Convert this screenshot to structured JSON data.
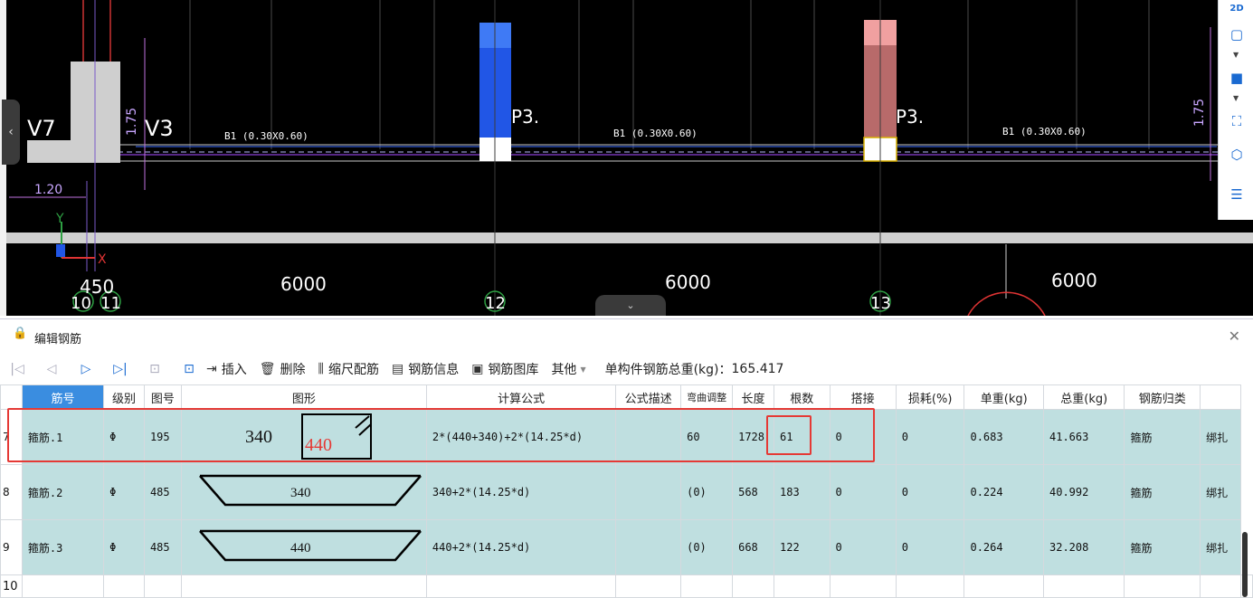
{
  "cad": {
    "axis_labels": [
      "10",
      "11",
      "12",
      "13"
    ],
    "dim_labels": [
      "450",
      "6000",
      "6000",
      "6000"
    ],
    "small_dim": "1.20",
    "vertical_dims": [
      "1.75",
      "1.75"
    ],
    "wall_labels": [
      "V7",
      "V3"
    ],
    "column_labels": [
      "P3.",
      "P3."
    ],
    "beam_labels": [
      "B1 (0.30X0.60)",
      "B1 (0.30X0.60)",
      "B1 (0.30X0.60)"
    ],
    "ucs": {
      "y": "Y",
      "x": "X"
    },
    "right_toolbar": [
      "2D",
      "cube-view",
      "solid-view",
      "zoom-extents",
      "3d-model",
      "layer-settings"
    ]
  },
  "panel": {
    "title": "编辑钢筋",
    "toolbar": {
      "insert": "插入",
      "delete": "删除",
      "scale_rebar": "缩尺配筋",
      "rebar_info": "钢筋信息",
      "rebar_library": "钢筋图库",
      "other": "其他",
      "total_weight_label": "单构件钢筋总重(kg)：",
      "total_weight": "165.417"
    },
    "columns": [
      "筋号",
      "级别",
      "图号",
      "图形",
      "计算公式",
      "公式描述",
      "弯曲调整",
      "长度",
      "根数",
      "搭接",
      "损耗(%)",
      "单重(kg)",
      "总重(kg)",
      "钢筋归类",
      ""
    ],
    "rows": [
      {
        "num": "7",
        "name": "箍筋.1",
        "grade": "Φ",
        "fig": "195",
        "shape_a": "340",
        "shape_b": "440",
        "formula": "2*(440+340)+2*(14.25*d)",
        "desc": "",
        "bend": "60",
        "length": "1728",
        "count": "61",
        "lap": "0",
        "loss": "0",
        "unit_w": "0.683",
        "total_w": "41.663",
        "category": "箍筋",
        "extra": "绑扎"
      },
      {
        "num": "8",
        "name": "箍筋.2",
        "grade": "Φ",
        "fig": "485",
        "shape_a": "340",
        "shape_b": "",
        "formula": "340+2*(14.25*d)",
        "desc": "",
        "bend": "(0)",
        "length": "568",
        "count": "183",
        "lap": "0",
        "loss": "0",
        "unit_w": "0.224",
        "total_w": "40.992",
        "category": "箍筋",
        "extra": "绑扎"
      },
      {
        "num": "9",
        "name": "箍筋.3",
        "grade": "Φ",
        "fig": "485",
        "shape_a": "440",
        "shape_b": "",
        "formula": "440+2*(14.25*d)",
        "desc": "",
        "bend": "(0)",
        "length": "668",
        "count": "122",
        "lap": "0",
        "loss": "0",
        "unit_w": "0.264",
        "total_w": "32.208",
        "category": "箍筋",
        "extra": "绑扎"
      }
    ],
    "empty_row_num": "10"
  },
  "colors": {
    "row_bg": "#bfdfe0",
    "highlight": "#e53935",
    "accent": "#3a8de0"
  }
}
